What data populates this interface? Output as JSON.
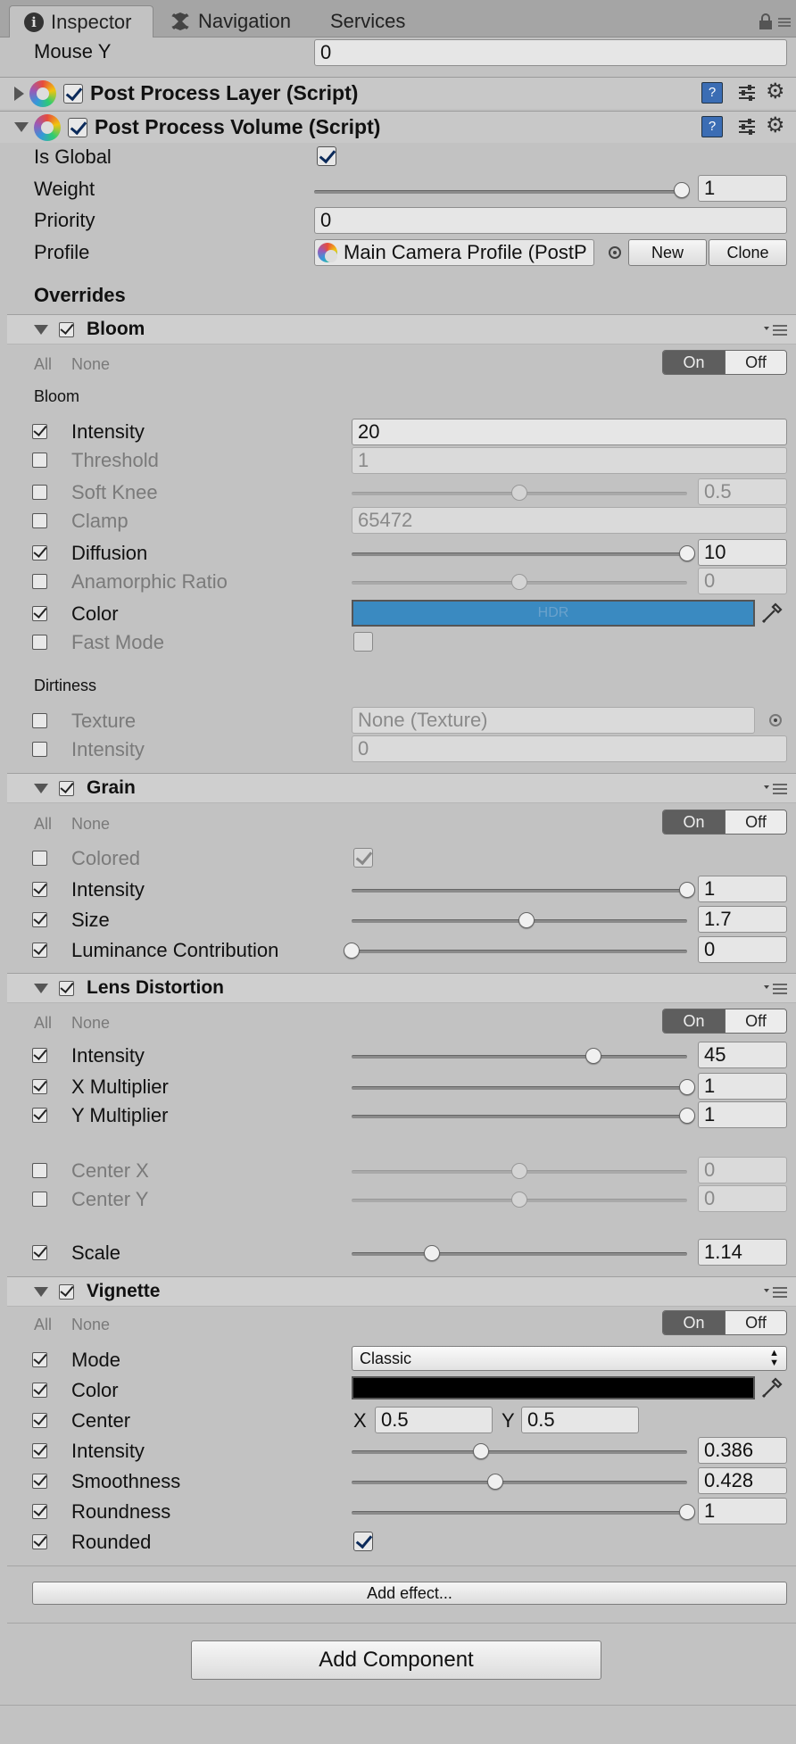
{
  "tabs": [
    {
      "label": "Inspector",
      "icon": "info-icon"
    },
    {
      "label": "Navigation",
      "icon": "navigation-icon"
    },
    {
      "label": "Services"
    }
  ],
  "top_field": {
    "label": "Mouse Y",
    "value": "0"
  },
  "components": {
    "layer": {
      "title": "Post Process Layer (Script)",
      "enabled": true,
      "expanded": false
    },
    "volume": {
      "title": "Post Process Volume (Script)",
      "enabled": true,
      "expanded": true
    }
  },
  "volume": {
    "is_global_label": "Is Global",
    "is_global": true,
    "weight_label": "Weight",
    "weight": "1",
    "weight_fraction": 1.0,
    "priority_label": "Priority",
    "priority": "0",
    "profile_label": "Profile",
    "profile_value": "Main Camera Profile (PostP",
    "new_label": "New",
    "clone_label": "Clone",
    "overrides_label": "Overrides"
  },
  "common": {
    "all": "All",
    "none": "None",
    "on": "On",
    "off": "Off"
  },
  "bloom": {
    "title": "Bloom",
    "section_bloom": "Bloom",
    "section_dirtiness": "Dirtiness",
    "intensity": {
      "label": "Intensity",
      "value": "20",
      "checked": true
    },
    "threshold": {
      "label": "Threshold",
      "value": "1",
      "checked": false
    },
    "soft_knee": {
      "label": "Soft Knee",
      "value": "0.5",
      "checked": false,
      "fraction": 0.5
    },
    "clamp": {
      "label": "Clamp",
      "value": "65472",
      "checked": false
    },
    "diffusion": {
      "label": "Diffusion",
      "value": "10",
      "checked": true,
      "fraction": 1.0
    },
    "anamorphic": {
      "label": "Anamorphic Ratio",
      "value": "0",
      "checked": false,
      "fraction": 0.5
    },
    "color": {
      "label": "Color",
      "checked": true,
      "swatch": "#3a8ac1",
      "hdr_text": "HDR"
    },
    "fast_mode": {
      "label": "Fast Mode",
      "checked": false
    },
    "texture": {
      "label": "Texture",
      "value": "None (Texture)",
      "checked": false
    },
    "dirt_intensity": {
      "label": "Intensity",
      "value": "0",
      "checked": false
    }
  },
  "grain": {
    "title": "Grain",
    "colored": {
      "label": "Colored",
      "checked": false
    },
    "intensity": {
      "label": "Intensity",
      "value": "1",
      "checked": true,
      "fraction": 1.0
    },
    "size": {
      "label": "Size",
      "value": "1.7",
      "checked": true,
      "fraction": 0.52
    },
    "luminance": {
      "label": "Luminance Contribution",
      "value": "0",
      "checked": true,
      "fraction": 0.0
    }
  },
  "lens": {
    "title": "Lens Distortion",
    "intensity": {
      "label": "Intensity",
      "value": "45",
      "checked": true,
      "fraction": 0.72
    },
    "x_mult": {
      "label": "X Multiplier",
      "value": "1",
      "checked": true,
      "fraction": 1.0
    },
    "y_mult": {
      "label": "Y Multiplier",
      "value": "1",
      "checked": true,
      "fraction": 1.0
    },
    "center_x": {
      "label": "Center X",
      "value": "0",
      "checked": false,
      "fraction": 0.5
    },
    "center_y": {
      "label": "Center Y",
      "value": "0",
      "checked": false,
      "fraction": 0.5
    },
    "scale": {
      "label": "Scale",
      "value": "1.14",
      "checked": true,
      "fraction": 0.24
    }
  },
  "vignette": {
    "title": "Vignette",
    "mode": {
      "label": "Mode",
      "value": "Classic",
      "checked": true
    },
    "color": {
      "label": "Color",
      "checked": true,
      "swatch": "#000000"
    },
    "center": {
      "label": "Center",
      "checked": true,
      "x_label": "X",
      "x": "0.5",
      "y_label": "Y",
      "y": "0.5"
    },
    "intensity": {
      "label": "Intensity",
      "value": "0.386",
      "checked": true,
      "fraction": 0.386
    },
    "smoothness": {
      "label": "Smoothness",
      "value": "0.428",
      "checked": true,
      "fraction": 0.428
    },
    "roundness": {
      "label": "Roundness",
      "value": "1",
      "checked": true,
      "fraction": 1.0
    },
    "rounded": {
      "label": "Rounded",
      "checked": true
    }
  },
  "add_effect_label": "Add effect...",
  "add_component_label": "Add Component"
}
